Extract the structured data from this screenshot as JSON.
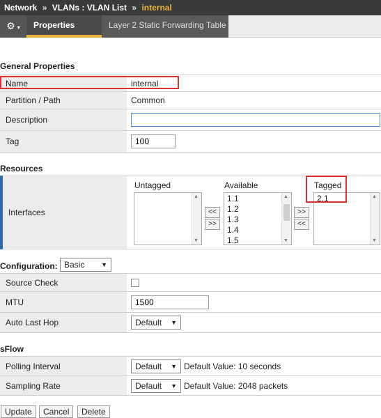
{
  "breadcrumb": {
    "network": "Network",
    "sep1": "»",
    "vlans": "VLANs : VLAN List",
    "sep2": "»",
    "current": "internal"
  },
  "tabs": {
    "gear_symbol": "⚙",
    "caret": "▾",
    "properties": "Properties",
    "l2_forwarding": "Layer 2 Static Forwarding Table"
  },
  "general": {
    "title": "General Properties",
    "name_label": "Name",
    "name_value": "internal",
    "partition_label": "Partition / Path",
    "partition_value": "Common",
    "description_label": "Description",
    "description_value": "",
    "tag_label": "Tag",
    "tag_value": "100"
  },
  "resources": {
    "title": "Resources",
    "interfaces_label": "Interfaces",
    "untagged_label": "Untagged",
    "available_label": "Available",
    "tagged_label": "Tagged",
    "available_items": [
      "1.1",
      "1.2",
      "1.3",
      "1.4",
      "1.5"
    ],
    "tagged_items": [
      "2.1"
    ],
    "move_right_1": ">>",
    "move_left_1": "<<",
    "move_right_2": ">>",
    "move_left_2": "<<"
  },
  "configuration": {
    "title": "Configuration:",
    "mode": "Basic",
    "source_check_label": "Source Check",
    "mtu_label": "MTU",
    "mtu_value": "1500",
    "auto_last_hop_label": "Auto Last Hop",
    "auto_last_hop_value": "Default"
  },
  "sflow": {
    "title": "sFlow",
    "polling_label": "Polling Interval",
    "polling_value": "Default",
    "polling_note": "Default Value: 10 seconds",
    "sampling_label": "Sampling Rate",
    "sampling_value": "Default",
    "sampling_note": "Default Value: 2048 packets"
  },
  "actions": {
    "update": "Update",
    "cancel": "Cancel",
    "delete": "Delete"
  },
  "colors": {
    "highlight": "#e03030",
    "tab_accent": "#e8b43a",
    "header_bg": "#3a3a3a"
  }
}
